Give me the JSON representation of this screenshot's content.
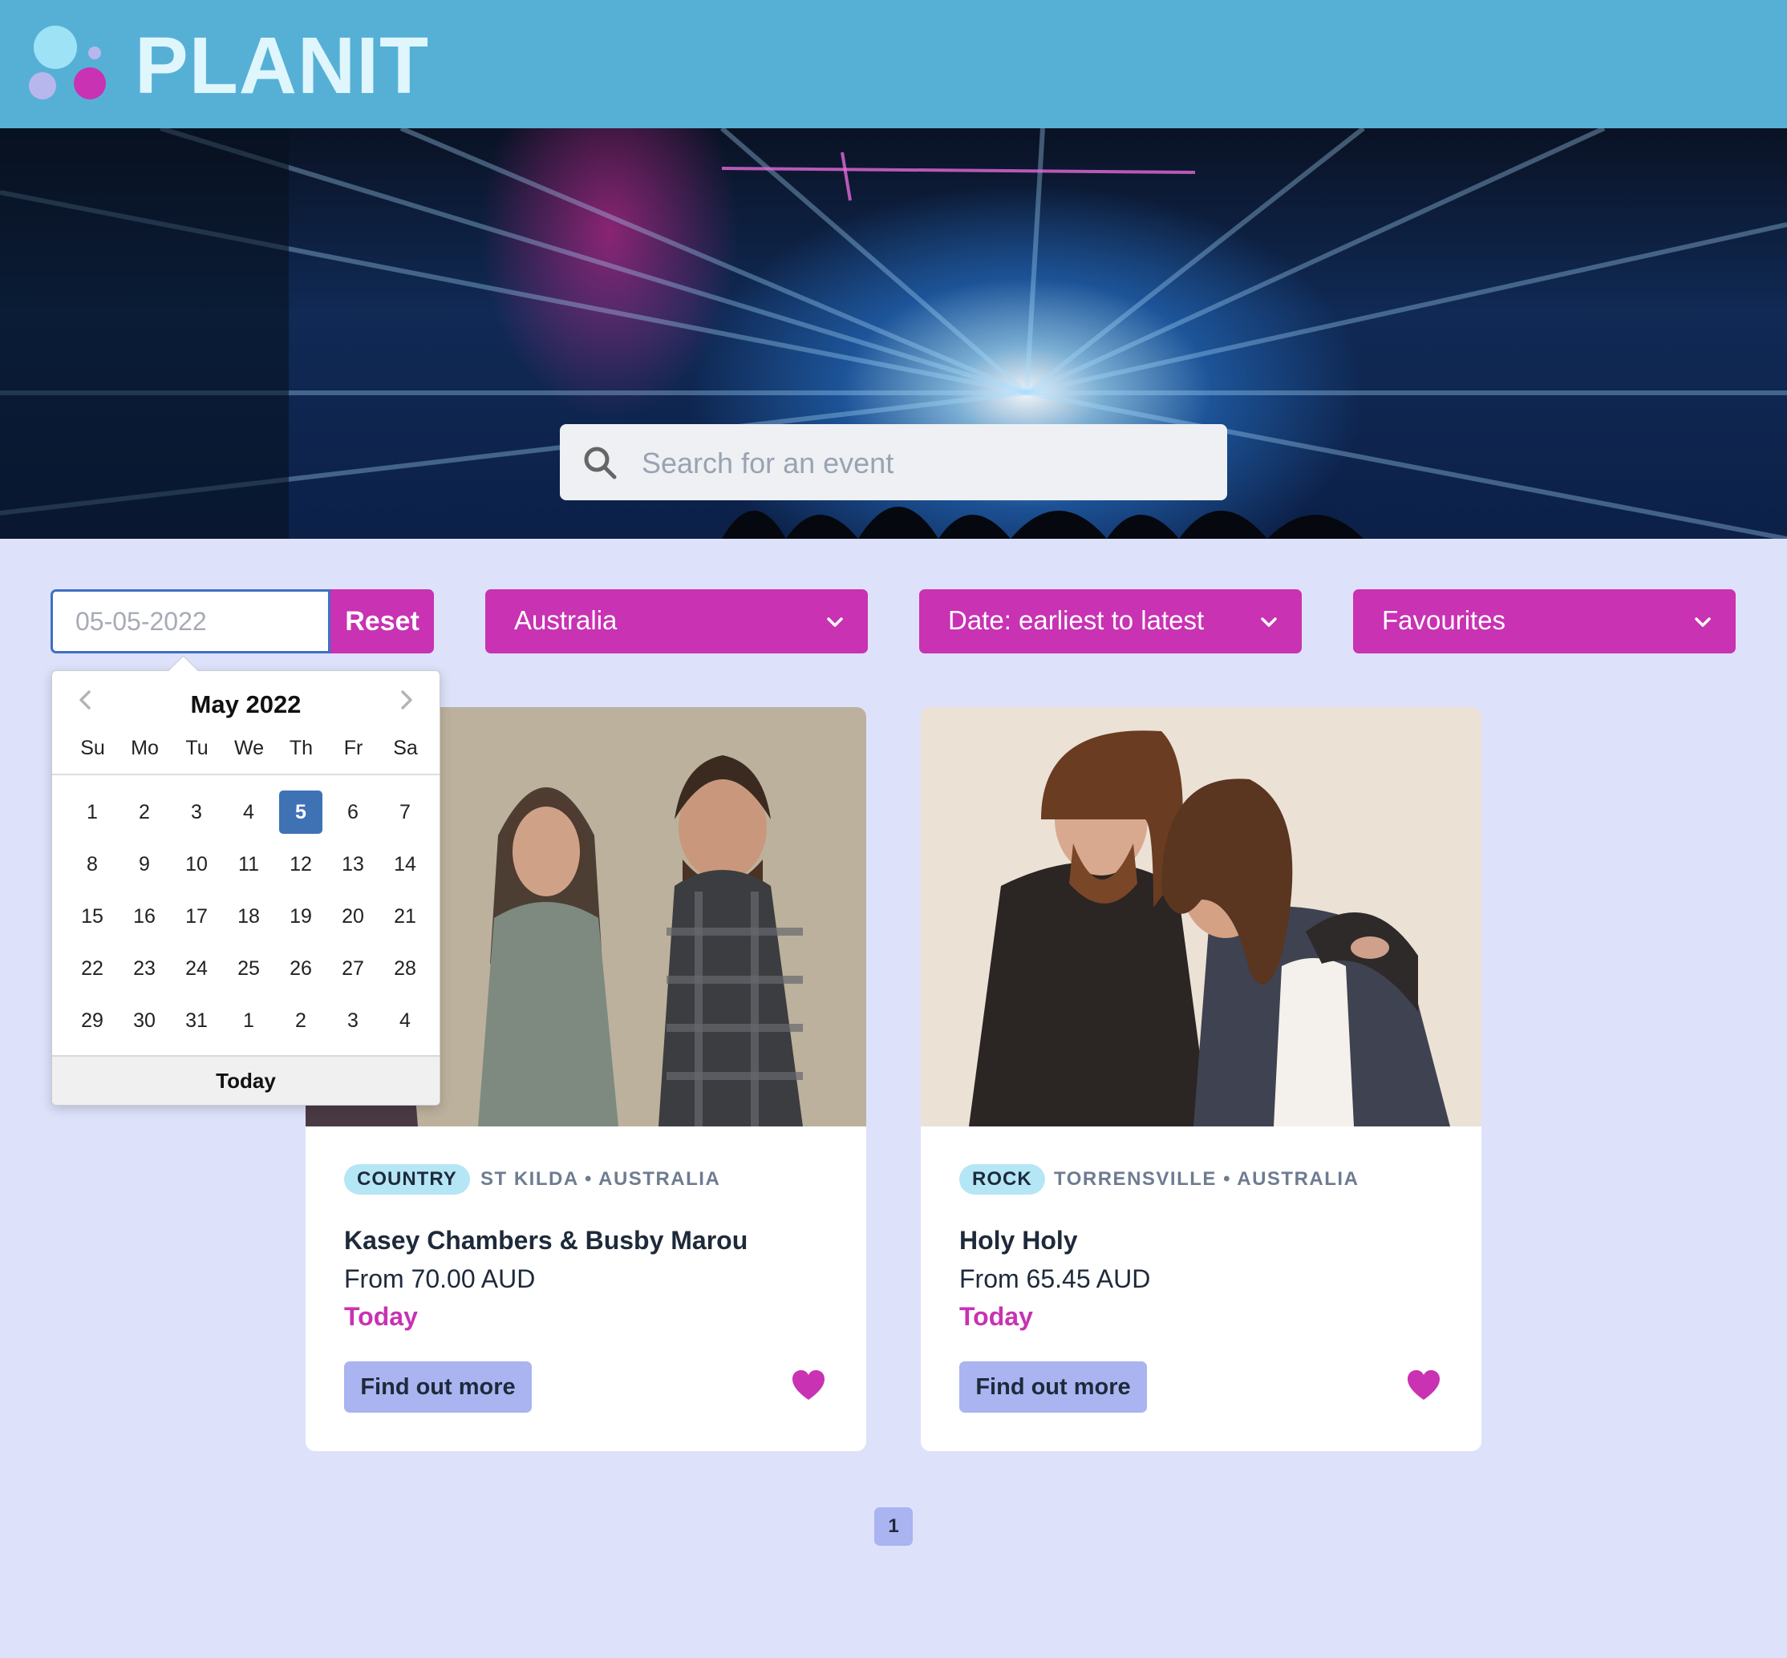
{
  "header": {
    "brand": "PLANIT"
  },
  "search": {
    "placeholder": "Search for an event"
  },
  "filters": {
    "date_placeholder": "05-05-2022",
    "reset_label": "Reset",
    "country": "Australia",
    "sort": "Date: earliest to latest",
    "favourites": "Favourites"
  },
  "datepicker": {
    "month_label": "May 2022",
    "weekdays": [
      "Su",
      "Mo",
      "Tu",
      "We",
      "Th",
      "Fr",
      "Sa"
    ],
    "weeks": [
      [
        "1",
        "2",
        "3",
        "4",
        "5",
        "6",
        "7"
      ],
      [
        "8",
        "9",
        "10",
        "11",
        "12",
        "13",
        "14"
      ],
      [
        "15",
        "16",
        "17",
        "18",
        "19",
        "20",
        "21"
      ],
      [
        "22",
        "23",
        "24",
        "25",
        "26",
        "27",
        "28"
      ],
      [
        "29",
        "30",
        "31",
        "1",
        "2",
        "3",
        "4"
      ]
    ],
    "selected": "5",
    "today_label": "Today"
  },
  "events": [
    {
      "genre": "COUNTRY",
      "location": "ST KILDA • AUSTRALIA",
      "title": "Kasey Chambers & Busby Marou",
      "price": "From 70.00 AUD",
      "when": "Today",
      "cta": "Find out more"
    },
    {
      "genre": "ROCK",
      "location": "TORRENSVILLE • AUSTRALIA",
      "title": "Holy Holy",
      "price": "From 65.45 AUD",
      "when": "Today",
      "cta": "Find out more"
    }
  ],
  "pagination": {
    "current": "1"
  },
  "colors": {
    "header": "#56b0d6",
    "accent": "#c832b3",
    "background": "#dde2fa",
    "button": "#a9b4f0",
    "selected_day": "#3f72b5"
  }
}
